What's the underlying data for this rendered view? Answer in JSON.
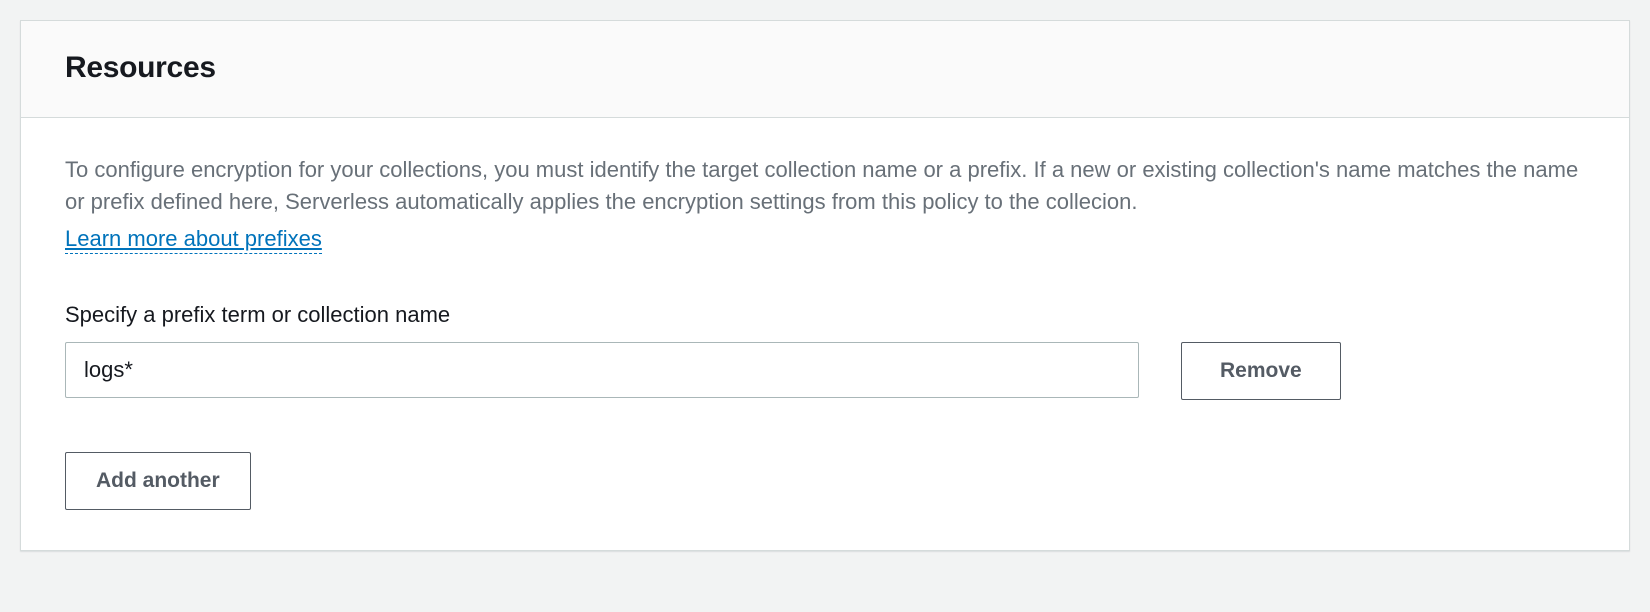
{
  "panel": {
    "title": "Resources",
    "description": "To configure encryption for your collections, you must identify the target collection name or a prefix. If a new or existing collection's name matches the name or prefix defined here, Serverless automatically applies the encryption settings from this policy to the collecion.",
    "learn_more_label": "Learn more about prefixes",
    "field_label": "Specify a prefix term or collection name",
    "rows": [
      {
        "value": "logs*",
        "remove_label": "Remove"
      }
    ],
    "add_label": "Add another"
  }
}
